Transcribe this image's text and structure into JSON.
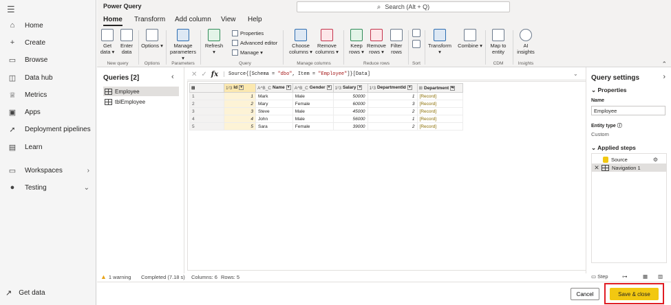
{
  "leftnav": {
    "items": [
      {
        "label": "Home",
        "icon": "home-icon",
        "glyph": "⌂"
      },
      {
        "label": "Create",
        "icon": "plus-icon",
        "glyph": "+"
      },
      {
        "label": "Browse",
        "icon": "folder-icon",
        "glyph": "▭"
      },
      {
        "label": "Data hub",
        "icon": "database-icon",
        "glyph": "◫"
      },
      {
        "label": "Metrics",
        "icon": "trophy-icon",
        "glyph": "♕"
      },
      {
        "label": "Apps",
        "icon": "apps-icon",
        "glyph": "▣"
      },
      {
        "label": "Deployment pipelines",
        "icon": "rocket-icon",
        "glyph": "➚"
      },
      {
        "label": "Learn",
        "icon": "book-icon",
        "glyph": "▤"
      },
      {
        "label": "Workspaces",
        "icon": "workspaces-icon",
        "glyph": "▭"
      },
      {
        "label": "Testing",
        "icon": "workspace-avatar-icon",
        "glyph": "●"
      }
    ],
    "get_data": "Get data"
  },
  "app": {
    "title": "Power Query",
    "search_placeholder": "Search (Alt + Q)"
  },
  "tabs": [
    "Home",
    "Transform",
    "Add column",
    "View",
    "Help"
  ],
  "ribbon": {
    "get_data": "Get data ▾",
    "enter_data": "Enter data",
    "options": "Options ▾",
    "manage_parameters": "Manage parameters ▾",
    "refresh": "Refresh ▾",
    "properties": "Properties",
    "advanced_editor": "Advanced editor",
    "manage": "Manage ▾",
    "choose_columns": "Choose columns ▾",
    "remove_columns": "Remove columns ▾",
    "keep_rows": "Keep rows ▾",
    "remove_rows": "Remove rows ▾",
    "filter_rows": "Filter rows",
    "transform": "Transform ▾",
    "combine": "Combine ▾",
    "map_to_entity": "Map to entity",
    "ai_insights": "AI insights",
    "groups": [
      "New query",
      "Options",
      "Parameters",
      "Query",
      "Manage columns",
      "Reduce rows",
      "Sort",
      "CDM",
      "Insights"
    ]
  },
  "queries": {
    "header": "Queries [2]",
    "items": [
      "Employee",
      "tblEmployee"
    ]
  },
  "formula": {
    "prefix": "Source{[Schema = ",
    "schema": "\"dbo\"",
    "mid": ", Item = ",
    "item": "\"Employee\"",
    "suffix": "]}[Data]"
  },
  "grid": {
    "columns": [
      {
        "type": "1²3",
        "name": "Id"
      },
      {
        "type": "A^B_C",
        "name": "Name"
      },
      {
        "type": "A^B_C",
        "name": "Gender"
      },
      {
        "type": "1²3",
        "name": "Salary"
      },
      {
        "type": "1²3",
        "name": "DepartmentId"
      },
      {
        "type": "⊞",
        "name": "Department"
      }
    ],
    "rows": [
      {
        "n": "1",
        "id": "1",
        "name": "Mark",
        "gender": "Male",
        "salary": "50000",
        "dept": "1",
        "rec": "[Record]"
      },
      {
        "n": "2",
        "id": "2",
        "name": "Mary",
        "gender": "Female",
        "salary": "60000",
        "dept": "3",
        "rec": "[Record]"
      },
      {
        "n": "3",
        "id": "3",
        "name": "Steve",
        "gender": "Male",
        "salary": "45000",
        "dept": "2",
        "rec": "[Record]"
      },
      {
        "n": "4",
        "id": "4",
        "name": "John",
        "gender": "Male",
        "salary": "56000",
        "dept": "1",
        "rec": "[Record]"
      },
      {
        "n": "5",
        "id": "5",
        "name": "Sara",
        "gender": "Female",
        "salary": "39000",
        "dept": "2",
        "rec": "[Record]"
      }
    ]
  },
  "settings": {
    "title": "Query settings",
    "properties": "Properties",
    "name_label": "Name",
    "name_value": "Employee",
    "entity_type_label": "Entity type ⓘ",
    "entity_type_value": "Custom",
    "applied_steps": "Applied steps",
    "steps": [
      "Source",
      "Navigation 1"
    ]
  },
  "status": {
    "warning": "1 warning",
    "completed": "Completed (7.18 s)",
    "columns": "Columns: 6",
    "rows": "Rows: 5",
    "step": "Step"
  },
  "footer": {
    "cancel": "Cancel",
    "save": "Save & close"
  }
}
